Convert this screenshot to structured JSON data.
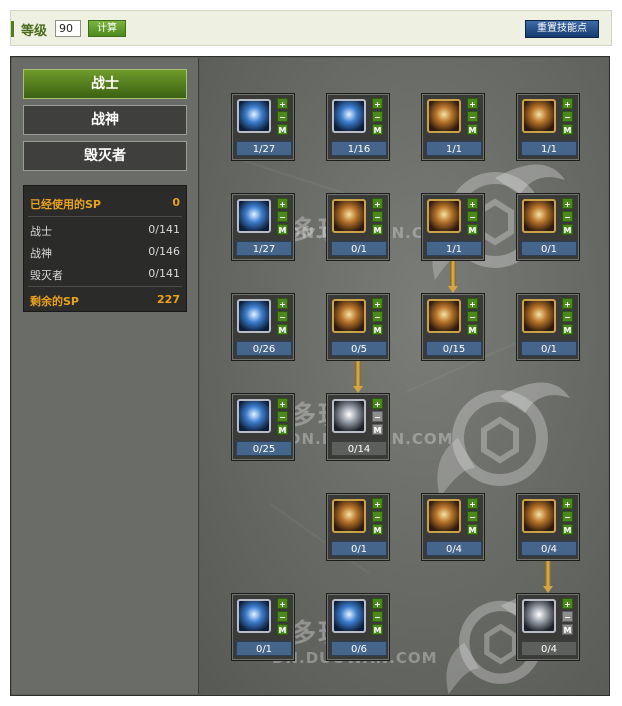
{
  "header": {
    "level_label": "等级",
    "level_value": "90",
    "calc_label": "计算",
    "reset_label": "重置技能点"
  },
  "tabs": [
    "战士",
    "战神",
    "毁灭者"
  ],
  "active_tab": 0,
  "sp_panel": {
    "used_label": "已经使用的SP",
    "used_value": "0",
    "rows": [
      {
        "label": "战士",
        "value": "0/141"
      },
      {
        "label": "战神",
        "value": "0/146"
      },
      {
        "label": "毁灭者",
        "value": "0/141"
      }
    ],
    "remaining_label": "剩余的SP",
    "remaining_value": "227"
  },
  "watermark": {
    "text": "多玩谷",
    "url": "DN.DUOWAN.COM"
  },
  "skill_buttons": {
    "plus": "+",
    "minus": "−",
    "max": "M"
  },
  "skills": [
    {
      "row": 0,
      "col": 0,
      "level": "1/27",
      "icon": "ice-blade-icon",
      "tone": "blue",
      "enabled": true
    },
    {
      "row": 0,
      "col": 1,
      "level": "1/16",
      "icon": "crescent-slash-icon",
      "tone": "blue",
      "enabled": true
    },
    {
      "row": 0,
      "col": 2,
      "level": "1/1",
      "icon": "fire-aura-icon",
      "tone": "gold",
      "enabled": true
    },
    {
      "row": 0,
      "col": 3,
      "level": "1/1",
      "icon": "boot-kick-icon",
      "tone": "gold",
      "enabled": true
    },
    {
      "row": 1,
      "col": 0,
      "level": "1/27",
      "icon": "triple-slash-icon",
      "tone": "blue",
      "enabled": true
    },
    {
      "row": 1,
      "col": 1,
      "level": "0/1",
      "icon": "warrior-stance-icon",
      "tone": "gold",
      "enabled": true
    },
    {
      "row": 1,
      "col": 2,
      "level": "1/1",
      "icon": "heart-shield-icon",
      "tone": "gold",
      "enabled": true
    },
    {
      "row": 1,
      "col": 3,
      "level": "0/1",
      "icon": "flame-fist-icon",
      "tone": "gold",
      "enabled": true
    },
    {
      "row": 2,
      "col": 0,
      "level": "0/26",
      "icon": "rising-wave-icon",
      "tone": "blue",
      "enabled": true
    },
    {
      "row": 2,
      "col": 1,
      "level": "0/5",
      "icon": "spin-attack-icon",
      "tone": "gold",
      "enabled": true
    },
    {
      "row": 2,
      "col": 2,
      "level": "0/15",
      "icon": "gauntlet-icon",
      "tone": "gold",
      "enabled": true
    },
    {
      "row": 2,
      "col": 3,
      "level": "0/1",
      "icon": "fist-icon",
      "tone": "gold",
      "enabled": true
    },
    {
      "row": 3,
      "col": 0,
      "level": "0/25",
      "icon": "ice-pillar-icon",
      "tone": "blue",
      "enabled": true
    },
    {
      "row": 3,
      "col": 1,
      "level": "0/14",
      "icon": "wing-strike-icon",
      "tone": "silver",
      "enabled": false
    },
    {
      "row": 4,
      "col": 1,
      "level": "0/1",
      "icon": "power-flex-icon",
      "tone": "gold",
      "enabled": true
    },
    {
      "row": 4,
      "col": 2,
      "level": "0/4",
      "icon": "rage-burst-icon",
      "tone": "gold",
      "enabled": true
    },
    {
      "row": 4,
      "col": 3,
      "level": "0/4",
      "icon": "explosion-icon",
      "tone": "gold",
      "enabled": true
    },
    {
      "row": 5,
      "col": 0,
      "level": "0/1",
      "icon": "shield-icon",
      "tone": "blue",
      "enabled": true
    },
    {
      "row": 5,
      "col": 1,
      "level": "0/6",
      "icon": "frost-orb-icon",
      "tone": "blue",
      "enabled": true
    },
    {
      "row": 5,
      "col": 3,
      "level": "0/4",
      "icon": "mp-boost-icon",
      "tone": "silver",
      "enabled": false
    }
  ],
  "arrows": [
    {
      "col": 2,
      "from_row": 1
    },
    {
      "col": 1,
      "from_row": 2
    },
    {
      "col": 3,
      "from_row": 4
    }
  ]
}
